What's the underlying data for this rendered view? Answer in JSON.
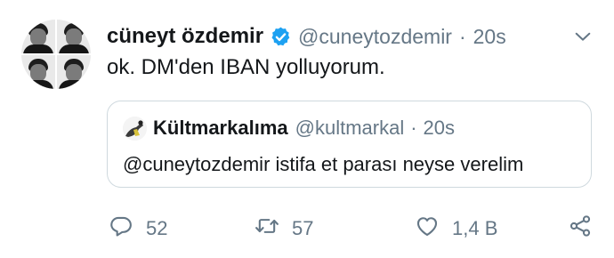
{
  "tweet": {
    "display_name": "cüneyt özdemir",
    "handle": "@cuneytozdemir",
    "separator": "·",
    "time": "20s",
    "text": "ok. DM'den IBAN yolluyorum."
  },
  "quoted": {
    "display_name": "Kültmarkalıma",
    "handle": "@kultmarkal",
    "separator": "·",
    "time": "20s",
    "text": "@cuneytozdemir istifa et parası neyse verelim"
  },
  "actions": {
    "reply_count": "52",
    "retweet_count": "57",
    "like_count": "1,4 B"
  },
  "icons": {
    "verified": "verified-badge-icon",
    "menu": "chevron-down-icon",
    "reply": "reply-icon",
    "retweet": "retweet-icon",
    "like": "heart-icon",
    "share": "share-icon"
  },
  "colors": {
    "verified_blue": "#1da1f2",
    "secondary_text": "#657786",
    "primary_text": "#14171a",
    "border": "#cfd9de"
  }
}
